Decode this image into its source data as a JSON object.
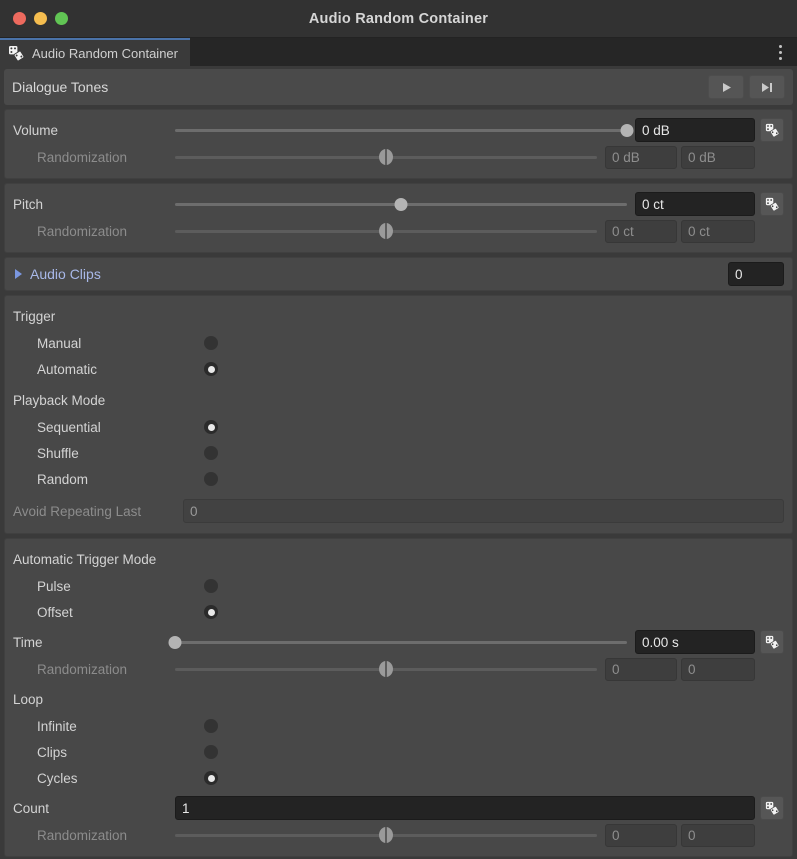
{
  "window": {
    "title": "Audio Random Container",
    "traffic_lights": [
      "close-red",
      "minimize-yellow",
      "zoom-green"
    ],
    "colors": {
      "red": "#ed6a5e",
      "yellow": "#f5bd4f",
      "green": "#61c554",
      "accent": "#4a72a8",
      "foldout_text": "#a8b8e8"
    }
  },
  "tab": {
    "label": "Audio Random Container",
    "icon": "dice-icon",
    "menu_icon": "kebab-menu-icon"
  },
  "header": {
    "title": "Dialogue Tones",
    "play_label": "▶",
    "skip_label": "▶|",
    "play_name": "play-button",
    "skip_name": "skip-button"
  },
  "volume": {
    "label": "Volume",
    "value": "0 dB",
    "slider_percent": 100,
    "randomization_label": "Randomization",
    "rand_min": "0 dB",
    "rand_max": "0 dB",
    "rand_slider_percent": 50
  },
  "pitch": {
    "label": "Pitch",
    "value": "0 ct",
    "slider_percent": 50,
    "randomization_label": "Randomization",
    "rand_min": "0 ct",
    "rand_max": "0 ct",
    "rand_slider_percent": 50
  },
  "audio_clips": {
    "label": "Audio Clips",
    "count": "0",
    "expanded": false
  },
  "trigger": {
    "title": "Trigger",
    "options": [
      {
        "label": "Manual",
        "selected": false
      },
      {
        "label": "Automatic",
        "selected": true
      }
    ]
  },
  "playback_mode": {
    "title": "Playback Mode",
    "options": [
      {
        "label": "Sequential",
        "selected": true
      },
      {
        "label": "Shuffle",
        "selected": false
      },
      {
        "label": "Random",
        "selected": false
      }
    ],
    "avoid_repeating_label": "Avoid Repeating Last",
    "avoid_repeating_value": "0"
  },
  "automatic_trigger_mode": {
    "title": "Automatic Trigger Mode",
    "options": [
      {
        "label": "Pulse",
        "selected": false
      },
      {
        "label": "Offset",
        "selected": true
      }
    ],
    "time_label": "Time",
    "time_value": "0.00 s",
    "time_slider_percent": 0,
    "time_rand_label": "Randomization",
    "time_rand_min": "0",
    "time_rand_max": "0",
    "time_rand_slider_percent": 50
  },
  "loop": {
    "title": "Loop",
    "options": [
      {
        "label": "Infinite",
        "selected": false
      },
      {
        "label": "Clips",
        "selected": false
      },
      {
        "label": "Cycles",
        "selected": true
      }
    ],
    "count_label": "Count",
    "count_value": "1",
    "count_rand_label": "Randomization",
    "count_rand_min": "0",
    "count_rand_max": "0",
    "count_rand_slider_percent": 50
  }
}
